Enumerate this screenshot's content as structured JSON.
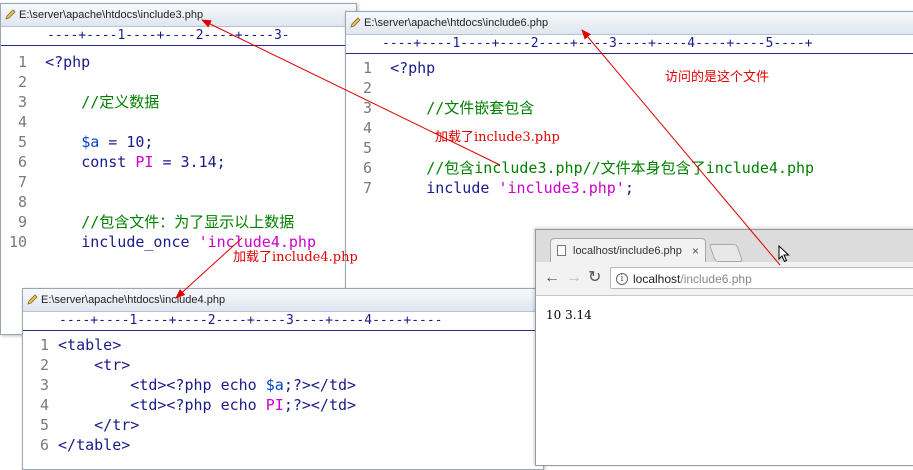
{
  "window3": {
    "title": "E:\\server\\apache\\htdocs\\include3.php",
    "ruler": "----+----1----+----2----+----3-",
    "lines": {
      "n1": "1",
      "n2": "2",
      "n3": "3",
      "n4": "4",
      "n5": "5",
      "n6": "6",
      "n7": "7",
      "n8": "8",
      "n9": "9",
      "n10": "10",
      "l1": "<?php",
      "l3": "//定义数据",
      "l5_var": "$a",
      "l5_op": " = ",
      "l5_num": "10;",
      "l6_kw": "const ",
      "l6_name": "PI",
      "l6_rest": " = 3.14;",
      "l9": "//包含文件：为了显示以上数据",
      "l10_kw": "include_once ",
      "l10_str": "'include4.php"
    }
  },
  "window6": {
    "title": "E:\\server\\apache\\htdocs\\include6.php",
    "ruler": "----+----1----+----2----+----3----+----4----+----5----+",
    "lines": {
      "n1": "1",
      "n2": "2",
      "n3": "3",
      "n4": "4",
      "n5": "5",
      "n6": "6",
      "n7": "7",
      "l1": "<?php",
      "l3": "//文件嵌套包含",
      "l6": "//包含include3.php//文件本身包含了include4.php",
      "l7_kw": "include ",
      "l7_str": "'include3.php'",
      "l7_end": ";"
    }
  },
  "window4": {
    "title": "E:\\server\\apache\\htdocs\\include4.php",
    "ruler": "----+----1----+----2----+----3----+----4----+----",
    "lines": {
      "n1": "1",
      "n2": "2",
      "n3": "3",
      "n4": "4",
      "n5": "5",
      "n6": "6",
      "l1": "<table>",
      "l2": "<tr>",
      "l3a": "<td><?php echo ",
      "l3b": "$a",
      "l3c": ";?></td>",
      "l4a": "<td><?php echo ",
      "l4b": "PI",
      "l4c": ";?></td>",
      "l5": "</tr>",
      "l6": "</table>"
    }
  },
  "browser": {
    "tab_title": "localhost/include6.php",
    "tab_close": "×",
    "url_host": "localhost",
    "url_path": "/include6.php",
    "page_output": "10 3.14"
  },
  "annotations": {
    "visited_file": "访问的是这个文件",
    "loaded_include3": "加载了include3.php",
    "loaded_include4": "加载了include4.php"
  },
  "colors": {
    "arrow": "#e00000",
    "keyword": "#1a1a8a",
    "comment": "#008000",
    "string": "#cc00cc",
    "variable": "#0044cc"
  }
}
